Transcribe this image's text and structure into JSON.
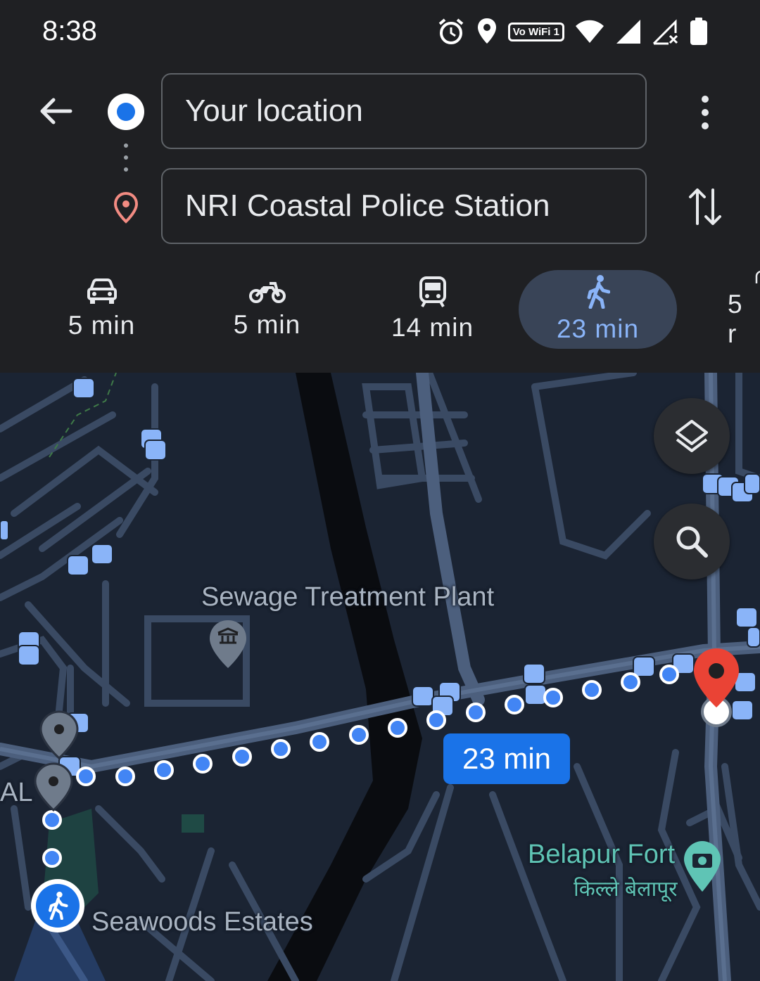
{
  "status_bar": {
    "time": "8:38",
    "icons": [
      "alarm-icon",
      "location-icon",
      "vowifi-icon",
      "wifi-icon",
      "signal-icon",
      "signal-no-service-icon",
      "battery-icon"
    ],
    "vowifi_text": "Vo WiFi 1"
  },
  "directions": {
    "origin": "Your location",
    "destination": "NRI Coastal Police Station"
  },
  "modes": [
    {
      "icon": "car-icon",
      "label": "5 min",
      "active": false
    },
    {
      "icon": "motorcycle-icon",
      "label": "5 min",
      "active": false
    },
    {
      "icon": "transit-icon",
      "label": "14 min",
      "active": false
    },
    {
      "icon": "walking-icon",
      "label": "23 min",
      "active": true
    },
    {
      "icon": "rideshare-icon",
      "label": "5 r",
      "active": false
    }
  ],
  "map": {
    "route_eta": "23 min",
    "places": {
      "sewage": "Sewage Treatment Plant",
      "fort": "Belapur Fort",
      "fort_local": "किल्ले बेलापूर",
      "estates": "Seawoods Estates",
      "edge_label": "AL"
    }
  },
  "colors": {
    "accent": "#1a73e8",
    "active_mode_text": "#8ab4f8",
    "active_mode_bg": "#394457",
    "destination_pin": "#ea4335",
    "map_bg": "#1b2433"
  }
}
